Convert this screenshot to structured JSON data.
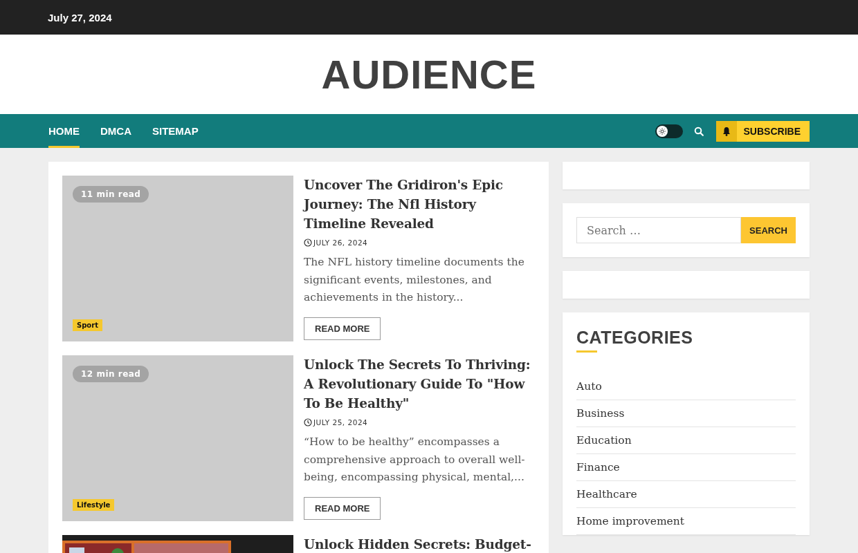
{
  "top_bar": {
    "date": "July 27, 2024"
  },
  "site_title": "AUDIENCE",
  "nav": {
    "items": [
      {
        "label": "HOME",
        "selected": true
      },
      {
        "label": "DMCA",
        "selected": false
      },
      {
        "label": "SITEMAP",
        "selected": false
      }
    ],
    "dark_mode_toggle": {
      "on": false
    },
    "subscribe": "SUBSCRIBE"
  },
  "posts": [
    {
      "image": {
        "kind": "placeholder"
      },
      "read_time": "11 min read",
      "category": "Sport",
      "title": "Uncover The Gridiron's Epic Journey: The Nfl History Timeline Revealed",
      "date": "JULY 26, 2024",
      "excerpt": "The NFL history timeline documents the significant events, milestones, and achievements in the history...",
      "button": "READ MORE"
    },
    {
      "image": {
        "kind": "placeholder"
      },
      "read_time": "12 min read",
      "category": "Lifestyle",
      "title": "Unlock The Secrets To Thriving: A Revolutionary Guide To \"How To Be Healthy\"",
      "date": "JULY 25, 2024",
      "excerpt": "“How to be healthy” encompasses a comprehensive approach to overall well-being, encompassing physical, mental,...",
      "button": "READ MORE"
    },
    {
      "title": "Unlock Hidden Secrets: Budget-"
    }
  ],
  "sidebar": {
    "search": {
      "placeholder": "Search …",
      "button": "SEARCH"
    },
    "categories": {
      "title": "CATEGORIES",
      "items": [
        "Auto",
        "Business",
        "Education",
        "Finance",
        "Healthcare",
        "Home improvement"
      ]
    }
  }
}
